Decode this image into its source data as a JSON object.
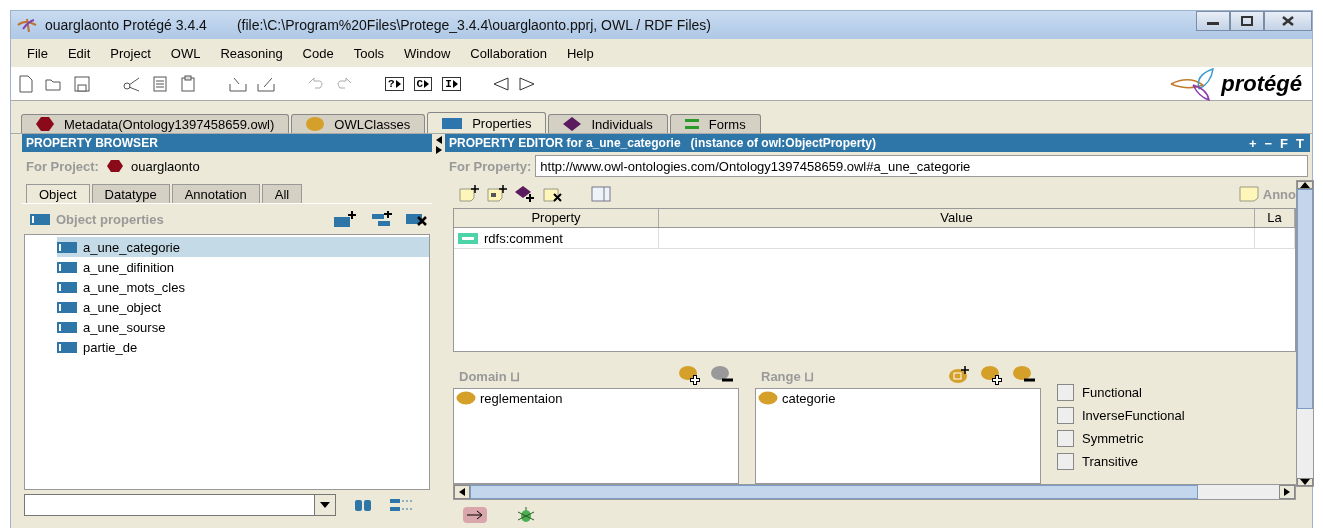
{
  "window": {
    "app_title": "ouarglaonto  Protégé 3.4.4",
    "file_info": "(file:\\C:\\Program%20Files\\Protege_3.4.4\\ouarglaonto.pprj, OWL / RDF Files)"
  },
  "menus": [
    {
      "label": "File"
    },
    {
      "label": "Edit"
    },
    {
      "label": "Project"
    },
    {
      "label": "OWL"
    },
    {
      "label": "Reasoning"
    },
    {
      "label": "Code"
    },
    {
      "label": "Tools"
    },
    {
      "label": "Window"
    },
    {
      "label": "Collaboration"
    },
    {
      "label": "Help"
    }
  ],
  "toolbar": {
    "query_buttons": [
      {
        "label": "?"
      },
      {
        "label": "C"
      },
      {
        "label": "I"
      }
    ],
    "logo": "protégé"
  },
  "tabs": [
    {
      "label": "Metadata(Ontology1397458659.owl)",
      "kind": "hexagon",
      "color": "#8b0a1a",
      "selected": false
    },
    {
      "label": "OWLClasses",
      "kind": "circle",
      "color": "#d4a02a",
      "selected": false
    },
    {
      "label": "Properties",
      "kind": "rect",
      "color": "#2e74ad",
      "selected": true
    },
    {
      "label": "Individuals",
      "kind": "diamond",
      "color": "#5a1a5e",
      "selected": false
    },
    {
      "label": "Forms",
      "kind": "equals",
      "color": "#2a9a2a",
      "selected": false
    }
  ],
  "browser": {
    "title": "PROPERTY BROWSER",
    "project_label": "For Project:",
    "project": "ouarglaonto",
    "subtabs": [
      {
        "label": "Object",
        "selected": true
      },
      {
        "label": "Datatype",
        "selected": false
      },
      {
        "label": "Annotation",
        "selected": false
      },
      {
        "label": "All",
        "selected": false
      }
    ],
    "section": "Object properties",
    "items": [
      {
        "label": "a_une_categorie",
        "selected": true
      },
      {
        "label": "a_une_difinition",
        "selected": false
      },
      {
        "label": "a_une_mots_cles",
        "selected": false
      },
      {
        "label": "a_une_object",
        "selected": false
      },
      {
        "label": "a_une_sourse",
        "selected": false
      },
      {
        "label": "partie_de",
        "selected": false
      }
    ]
  },
  "editor": {
    "title": "PROPERTY EDITOR for a_une_categorie   (instance of owl:ObjectProperty)",
    "header_buttons": [
      {
        "label": "+"
      },
      {
        "label": "−"
      },
      {
        "label": "F"
      },
      {
        "label": "T"
      }
    ],
    "property_label": "For Property:",
    "property_value": "http://www.owl-ontologies.com/Ontology1397458659.owl#a_une_categorie",
    "annotations_label": "Anno",
    "table": {
      "columns": [
        "Property",
        "Value",
        "La"
      ],
      "rows": [
        {
          "property": "rdfs:comment"
        }
      ]
    },
    "domain": {
      "label": "Domain ⊔",
      "items": [
        "reglementaion"
      ]
    },
    "range": {
      "label": "Range ⊔",
      "items": [
        "categorie"
      ]
    },
    "characteristics": [
      {
        "label": "Functional",
        "checked": false
      },
      {
        "label": "InverseFunctional",
        "checked": false
      },
      {
        "label": "Symmetric",
        "checked": false
      },
      {
        "label": "Transitive",
        "checked": false
      }
    ]
  }
}
